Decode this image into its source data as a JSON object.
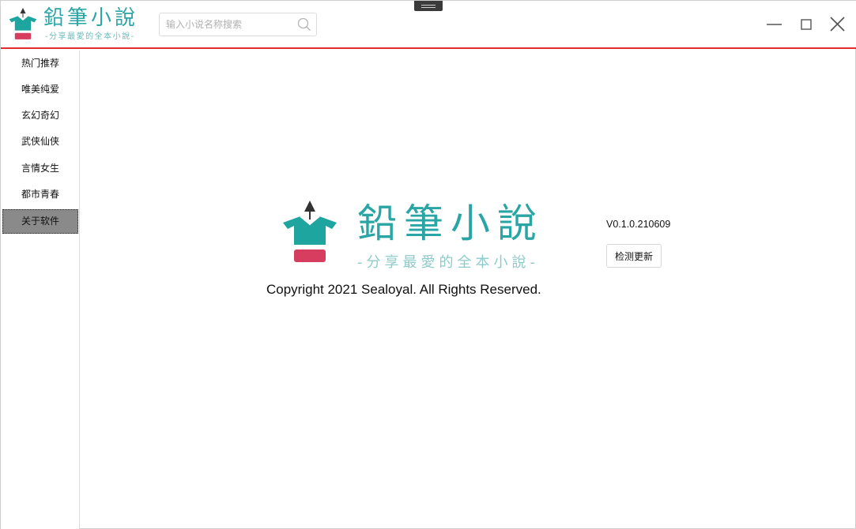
{
  "app": {
    "brand_name": "鉛筆小說",
    "brand_tagline": "-分享最愛的全本小說-",
    "brand_color": "#2aa5a6",
    "accent_color": "#e32b2b"
  },
  "search": {
    "placeholder": "输入小说名称搜索",
    "value": "",
    "icon": "search-icon"
  },
  "window_controls": {
    "minimize_icon": "minimize-icon",
    "maximize_icon": "maximize-icon",
    "close_icon": "close-icon"
  },
  "sidebar": {
    "items": [
      {
        "label": "热门推荐",
        "active": false
      },
      {
        "label": "唯美纯爱",
        "active": false
      },
      {
        "label": "玄幻奇幻",
        "active": false
      },
      {
        "label": "武侠仙侠",
        "active": false
      },
      {
        "label": "言情女生",
        "active": false
      },
      {
        "label": "都市青春",
        "active": false
      },
      {
        "label": "关于软件",
        "active": true
      }
    ]
  },
  "about": {
    "copyright": "Copyright 2021 Sealoyal. All Rights Reserved.",
    "version": "V0.1.0.210609",
    "update_button": "检测更新"
  }
}
